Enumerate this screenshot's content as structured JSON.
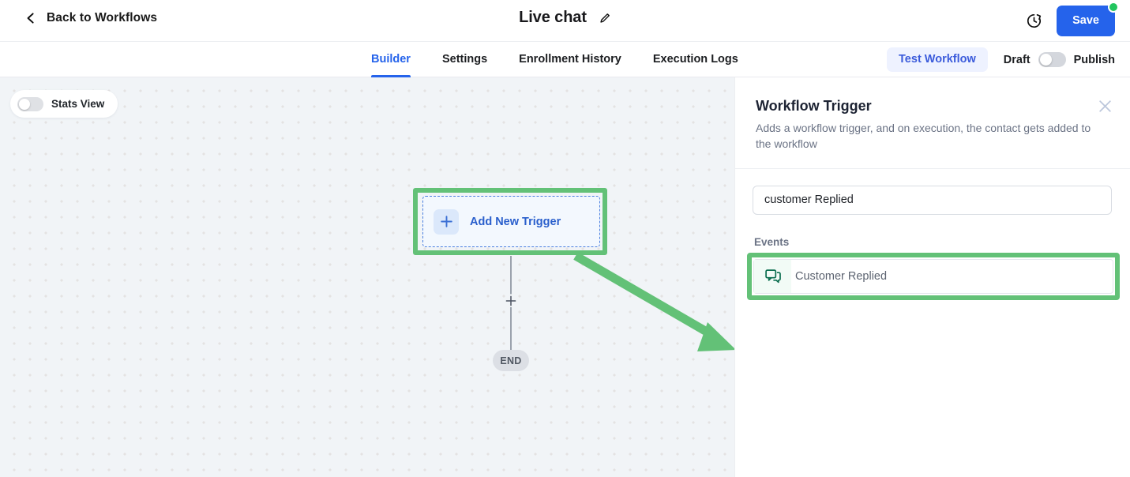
{
  "topbar": {
    "back_label": "Back to Workflows",
    "back_icon": "chevron-left-icon",
    "workflow_title": "Live chat",
    "edit_icon": "pencil-icon",
    "history_icon": "clock-history-icon",
    "save_label": "Save",
    "save_has_unsaved_dot": true
  },
  "tabbar": {
    "tabs": [
      {
        "label": "Builder",
        "active": true
      },
      {
        "label": "Settings",
        "active": false
      },
      {
        "label": "Enrollment History",
        "active": false
      },
      {
        "label": "Execution Logs",
        "active": false
      }
    ],
    "test_workflow_label": "Test Workflow",
    "draft_label": "Draft",
    "publish_label": "Publish",
    "publish_toggle_on": false
  },
  "canvas": {
    "stats_view_label": "Stats View",
    "stats_view_toggle_on": false,
    "trigger_node": {
      "label": "Add New Trigger",
      "icon": "plus-icon",
      "highlighted": true
    },
    "add_step_icon": "plus-icon",
    "end_node_label": "END",
    "annotation_arrow": {
      "color": "#63c177",
      "from": "add-new-trigger-node",
      "to": "customer-replied-event"
    },
    "highlight_color": "#63c177"
  },
  "panel": {
    "title": "Workflow Trigger",
    "description": "Adds a workflow trigger, and on execution, the contact gets added to the workflow",
    "close_icon": "close-icon",
    "search_value": "customer Replied",
    "search_placeholder": "Search",
    "events_label": "Events",
    "events": [
      {
        "name": "Customer Replied",
        "icon": "chat-bubbles-icon",
        "highlighted": true
      }
    ]
  },
  "colors": {
    "accent_blue": "#2563eb",
    "annotation_green": "#63c177",
    "canvas_bg": "#f1f4f7",
    "event_icon_green": "#0b6e4f"
  }
}
